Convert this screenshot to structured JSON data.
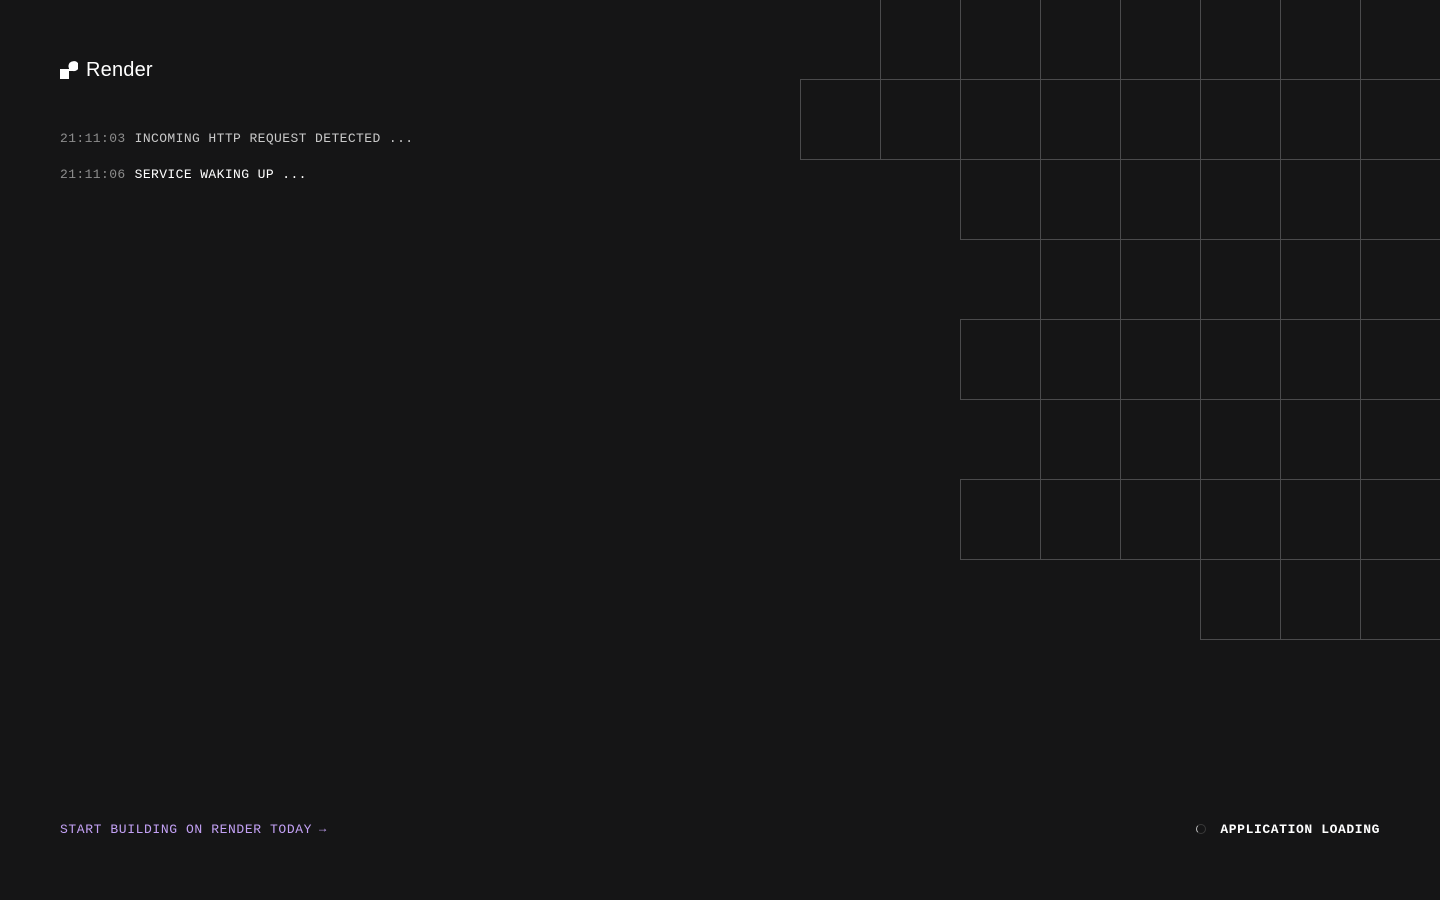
{
  "brand": {
    "name": "Render",
    "logo_icon": "render-logo-icon"
  },
  "log": [
    {
      "time": "21:11:03",
      "message": "INCOMING HTTP REQUEST DETECTED ..."
    },
    {
      "time": "21:11:06",
      "message": "SERVICE WAKING UP ..."
    }
  ],
  "footer": {
    "cta_label": "START BUILDING ON RENDER TODAY",
    "cta_arrow": "→",
    "status_label": "APPLICATION LOADING",
    "status_icon": "loading-spinner-icon"
  },
  "colors": {
    "background": "#151516",
    "grid_line": "#4a4a4c",
    "cta": "#c3a1f5",
    "text": "#ffffff",
    "timestamp": "#8d8d8d"
  }
}
